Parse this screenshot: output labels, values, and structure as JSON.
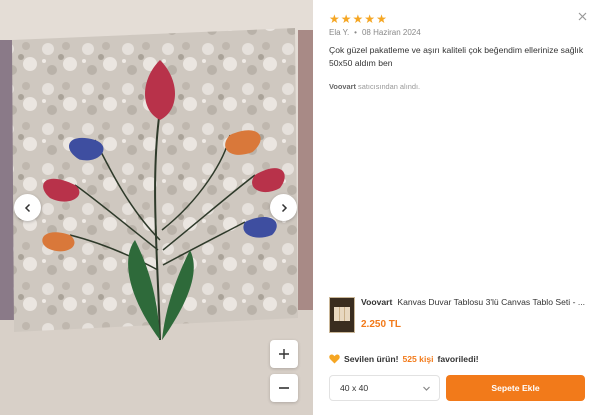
{
  "review": {
    "rating": 5,
    "stars": [
      "★",
      "★",
      "★",
      "★",
      "★"
    ],
    "author": "Ela Y.",
    "separator": "•",
    "date": "08 Haziran 2024",
    "text": "Çok güzel pakatleme ve aşırı kaliteli çok beğendim ellerinize sağlık 50x50 aldım ben",
    "seller_name": "Voovart",
    "seller_suffix": "satıcısından alındı."
  },
  "product": {
    "brand": "Voovart",
    "title": "Kanvas Duvar Tablosu 3'lü Canvas Tablo Seti - ...",
    "price": "2.250 TL"
  },
  "favorites": {
    "label": "Sevilen ürün!",
    "count": "525 kişi",
    "suffix": "favoriledi!"
  },
  "size_select": {
    "selected": "40 x 40"
  },
  "actions": {
    "add_to_cart": "Sepete Ekle"
  },
  "gallery": {
    "zoom_in": "+",
    "zoom_out": "−"
  },
  "colors": {
    "accent": "#f27a1a",
    "star": "#f5a623",
    "tulip_red": "#b8324a",
    "tulip_blue": "#3e4ea0",
    "tulip_orange": "#d9783a",
    "stem_green": "#2e6a3a"
  },
  "icons": {
    "close": "close-icon",
    "prev": "chevron-left-icon",
    "next": "chevron-right-icon",
    "heart": "heart-icon",
    "dropdown": "chevron-down-icon"
  }
}
